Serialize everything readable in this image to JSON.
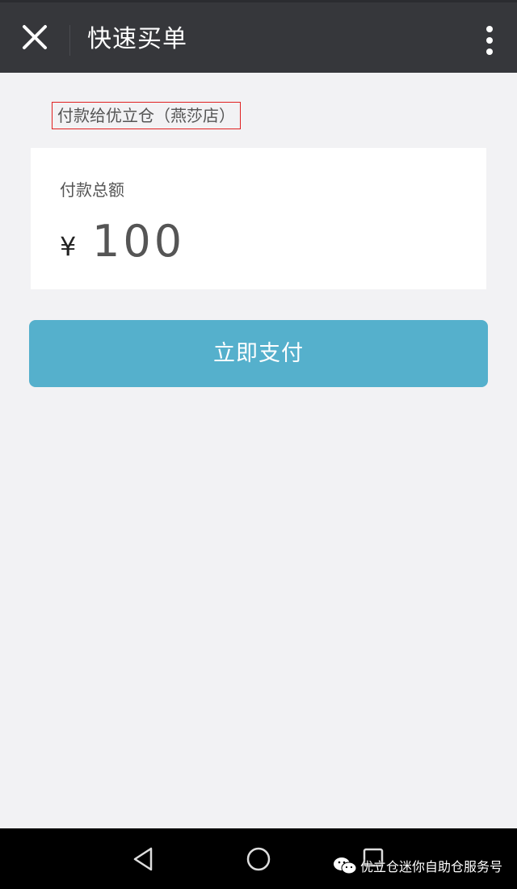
{
  "header": {
    "title": "快速买单",
    "close_icon": "close-icon",
    "more_icon": "more-vertical-icon"
  },
  "merchant": {
    "label": "付款给优立仓（燕莎店）"
  },
  "amount": {
    "label": "付款总额",
    "currency": "¥",
    "value": "100"
  },
  "pay_button": {
    "label": "立即支付"
  },
  "navbar": {
    "back_icon": "back-triangle-icon",
    "home_icon": "home-circle-icon",
    "recent_icon": "recent-apps-square-icon"
  },
  "watermark": {
    "text": "优立仓迷你自助仓服务号",
    "icon": "wechat-icon"
  },
  "colors": {
    "topbar": "#36373b",
    "background": "#f2f2f4",
    "pay_button": "#55b0cc",
    "merchant_border": "#e02020"
  }
}
